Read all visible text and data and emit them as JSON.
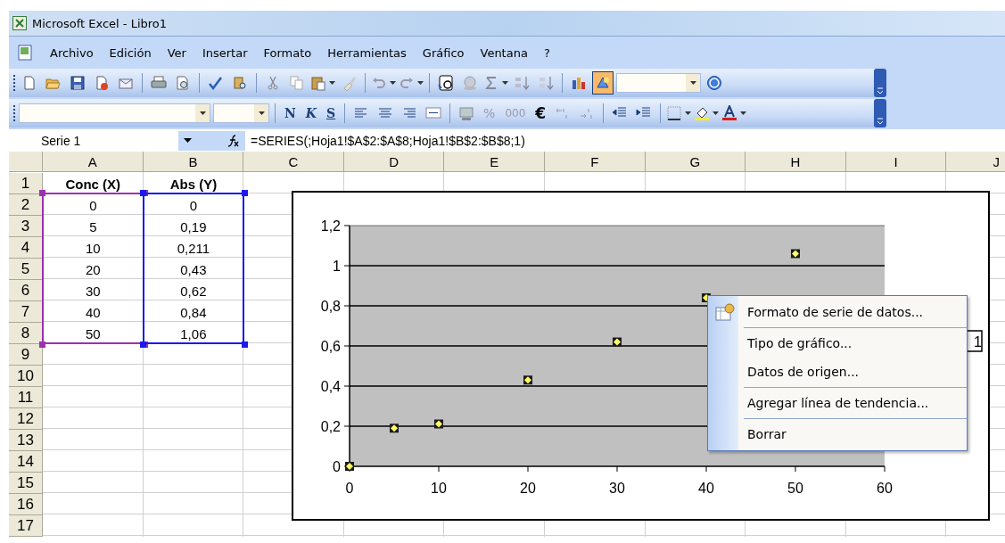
{
  "window": {
    "title": "Microsoft Excel - Libro1"
  },
  "menu_bar": {
    "items": [
      "Archivo",
      "Edición",
      "Ver",
      "Insertar",
      "Formato",
      "Herramientas",
      "Gráfico",
      "Ventana",
      "?"
    ]
  },
  "standard_toolbar": {
    "chart_wizard_pressed": true
  },
  "formatting_toolbar": {
    "bold": "N",
    "italic": "K",
    "underline": "S",
    "percent": "%",
    "thousands": "000",
    "currency": "€"
  },
  "formula_bar": {
    "name_box": "Serie 1",
    "formula": "=SERIES(;Hoja1!$A$2:$A$8;Hoja1!$B$2:$B$8;1)"
  },
  "sheet": {
    "columns": [
      "A",
      "B",
      "C",
      "D",
      "E",
      "F",
      "G",
      "H",
      "I",
      "J"
    ],
    "rows": [
      {
        "header": "1",
        "bold": true,
        "cells": [
          "Conc (X)",
          "Abs (Y)"
        ]
      },
      {
        "header": "2",
        "bold": false,
        "cells": [
          "0",
          "0"
        ]
      },
      {
        "header": "3",
        "bold": false,
        "cells": [
          "5",
          "0,19"
        ]
      },
      {
        "header": "4",
        "bold": false,
        "cells": [
          "10",
          "0,211"
        ]
      },
      {
        "header": "5",
        "bold": false,
        "cells": [
          "20",
          "0,43"
        ]
      },
      {
        "header": "6",
        "bold": false,
        "cells": [
          "30",
          "0,62"
        ]
      },
      {
        "header": "7",
        "bold": false,
        "cells": [
          "40",
          "0,84"
        ]
      },
      {
        "header": "8",
        "bold": false,
        "cells": [
          "50",
          "1,06"
        ]
      },
      {
        "header": "9"
      },
      {
        "header": "10"
      },
      {
        "header": "11"
      },
      {
        "header": "12"
      },
      {
        "header": "13"
      },
      {
        "header": "14"
      },
      {
        "header": "15"
      },
      {
        "header": "16"
      },
      {
        "header": "17"
      }
    ],
    "range_highlights": [
      {
        "color": "#9b30b0"
      },
      {
        "color": "#1a1aee"
      }
    ]
  },
  "chart": {
    "chart_data": {
      "type": "scatter",
      "x": [
        0,
        5,
        10,
        20,
        30,
        40,
        50
      ],
      "grid": true,
      "series": [
        {
          "name": "1",
          "color": "#ffff66",
          "values": [
            0,
            0.19,
            0.211,
            0.43,
            0.62,
            0.84,
            1.06
          ]
        }
      ],
      "xlim": [
        0,
        60
      ],
      "ylim": [
        0,
        1.2
      ],
      "xticks": [
        0,
        10,
        20,
        30,
        40,
        50,
        60
      ],
      "yticks": [
        {
          "value": 0,
          "label": "0"
        },
        {
          "value": 0.2,
          "label": "0,2"
        },
        {
          "value": 0.4,
          "label": "0,4"
        },
        {
          "value": 0.6,
          "label": "0,6"
        },
        {
          "value": 0.8,
          "label": "0,8"
        },
        {
          "value": 1,
          "label": "1"
        },
        {
          "value": 1.2,
          "label": "1,2"
        }
      ]
    },
    "legend": {
      "visible": true
    }
  },
  "context_menu": {
    "items": [
      {
        "kind": "item",
        "label": "Formato de serie de datos...",
        "has_icon": true
      },
      {
        "kind": "separator"
      },
      {
        "kind": "item",
        "label": "Tipo de gráfico...",
        "has_icon": false
      },
      {
        "kind": "item",
        "label": "Datos de origen...",
        "has_icon": false
      },
      {
        "kind": "separator"
      },
      {
        "kind": "item",
        "label": "Agregar línea de tendencia...",
        "has_icon": false
      },
      {
        "kind": "separator"
      },
      {
        "kind": "item",
        "label": "Borrar",
        "has_icon": false
      }
    ]
  }
}
